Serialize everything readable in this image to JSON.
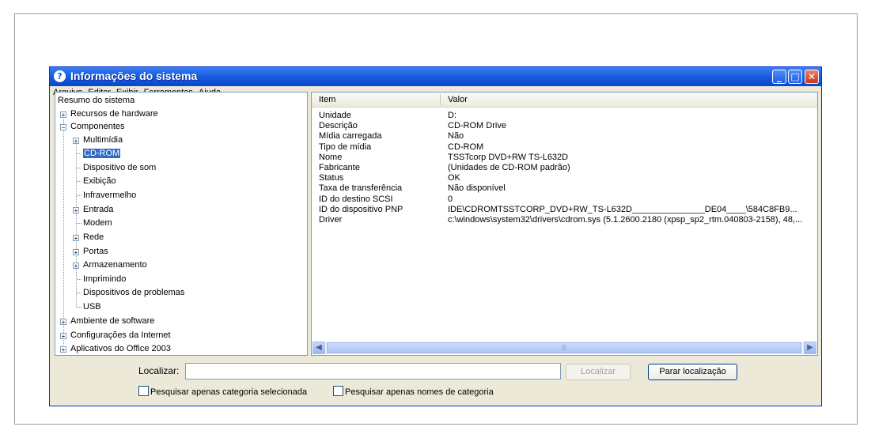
{
  "window": {
    "title": "Informações do sistema"
  },
  "menu": [
    "Arquivo",
    "Editar",
    "Exibir",
    "Ferramentas",
    "Ajuda"
  ],
  "tree": {
    "root": "Resumo do sistema",
    "recursos": "Recursos de hardware",
    "componentes": "Componentes",
    "children": [
      "Multimídia",
      "CD-ROM",
      "Dispositivo de som",
      "Exibição",
      "Infravermelho",
      "Entrada",
      "Modem",
      "Rede",
      "Portas",
      "Armazenamento",
      "Imprimindo",
      "Dispositivos de problemas",
      "USB"
    ],
    "ambiente": "Ambiente de software",
    "internet": "Configurações da Internet",
    "office": "Aplicativos do Office 2003"
  },
  "list": {
    "col_item": "Item",
    "col_value": "Valor",
    "rows": [
      {
        "item": "Unidade",
        "value": "D:"
      },
      {
        "item": "Descrição",
        "value": "CD-ROM Drive"
      },
      {
        "item": "Mídia carregada",
        "value": "Não"
      },
      {
        "item": "Tipo de mídia",
        "value": "CD-ROM"
      },
      {
        "item": "Nome",
        "value": "TSSTcorp DVD+RW TS-L632D"
      },
      {
        "item": "Fabricante",
        "value": "(Unidades de CD-ROM padrão)"
      },
      {
        "item": "Status",
        "value": "OK"
      },
      {
        "item": "Taxa de transferência",
        "value": "Não disponível"
      },
      {
        "item": "ID do destino SCSI",
        "value": "0"
      },
      {
        "item": "ID do dispositivo PNP",
        "value": "IDE\\CDROMTSSTCORP_DVD+RW_TS-L632D_______________DE04____\\584C8FB9..."
      },
      {
        "item": "Driver",
        "value": "c:\\windows\\system32\\drivers\\cdrom.sys (5.1.2600.2180 (xpsp_sp2_rtm.040803-2158), 48,..."
      }
    ]
  },
  "search": {
    "label": "Localizar:",
    "value": "",
    "find_button": "Localizar",
    "stop_button": "Parar localização",
    "check1": "Pesquisar apenas categoria selecionada",
    "check2": "Pesquisar apenas nomes de categoria"
  },
  "colors": {
    "title_blue": "#0a46cc",
    "selection": "#316ac5",
    "window_bg": "#ece9d8"
  }
}
